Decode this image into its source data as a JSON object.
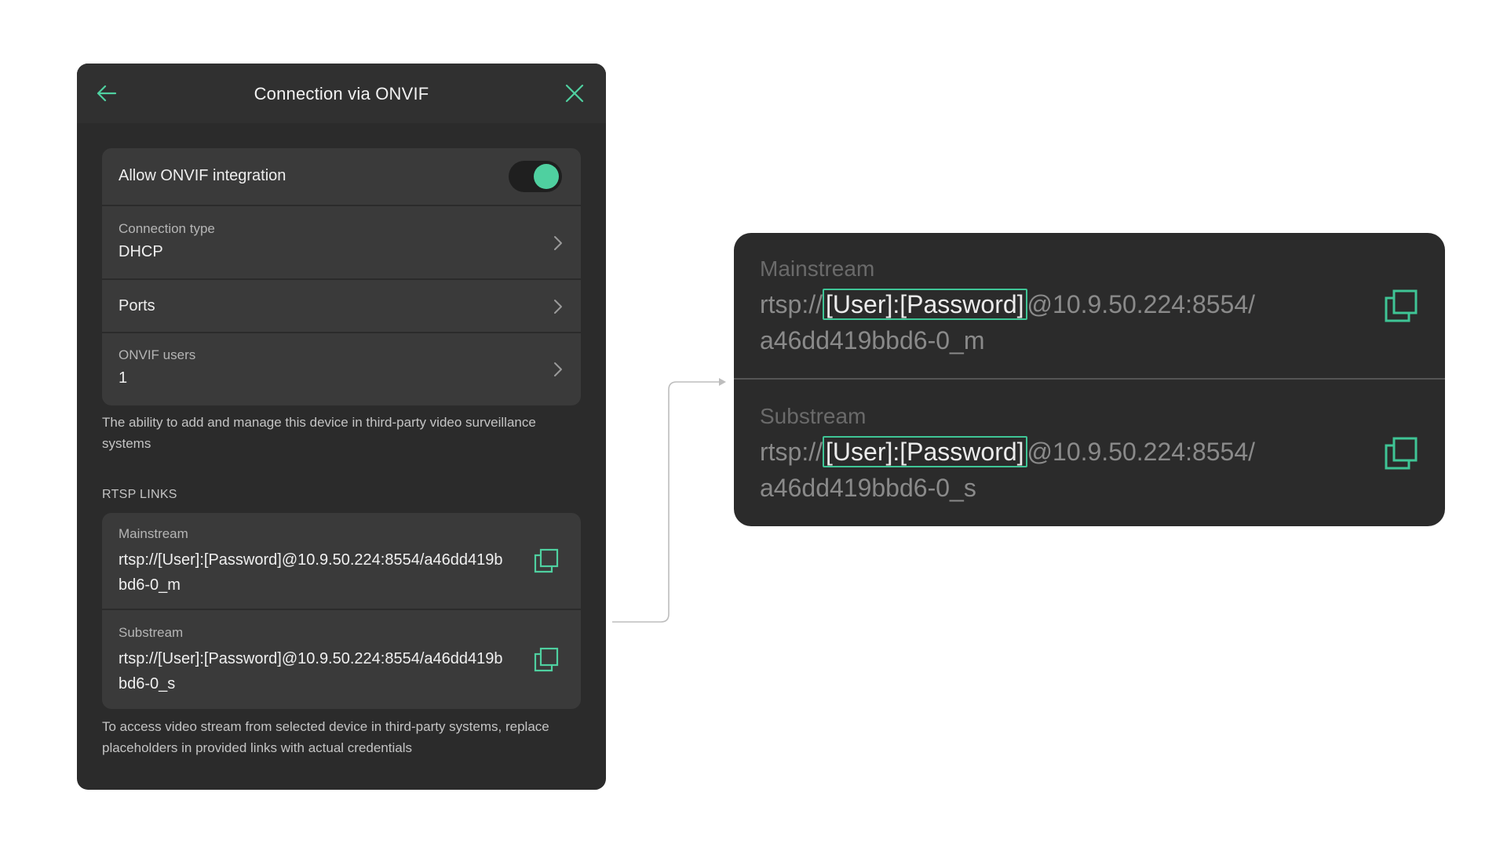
{
  "dialog": {
    "title": "Connection via ONVIF",
    "allow_onvif": {
      "label": "Allow ONVIF integration",
      "enabled": true
    },
    "connection_type": {
      "label": "Connection type",
      "value": "DHCP"
    },
    "ports": {
      "label": "Ports"
    },
    "onvif_users": {
      "label": "ONVIF users",
      "value": "1"
    },
    "integration_hint": "The ability to add and manage this device in third-party video surveillance systems",
    "rtsp_section_label": "RTSP LINKS",
    "rtsp_links": [
      {
        "label": "Mainstream",
        "url": "rtsp://[User]:[Password]@10.9.50.224:8554/a46dd419bbd6-0_m"
      },
      {
        "label": "Substream",
        "url": "rtsp://[User]:[Password]@10.9.50.224:8554/a46dd419bbd6-0_s"
      }
    ],
    "rtsp_hint": "To access video stream from selected device in third-party systems, replace placeholders in provided links with actual credentials"
  },
  "zoom": {
    "links": [
      {
        "label": "Mainstream",
        "prefix": "rtsp://",
        "credentials": "[User]:[Password]",
        "host": "@10.9.50.224:8554/",
        "path": "a46dd419bbd6-0_m"
      },
      {
        "label": "Substream",
        "prefix": "rtsp://",
        "credentials": "[User]:[Password]",
        "host": "@10.9.50.224:8554/",
        "path": "a46dd419bbd6-0_s"
      }
    ]
  },
  "colors": {
    "accent": "#4fd0a0",
    "highlight_border": "#3fc596",
    "panel_bg": "#2b2b2b",
    "card_bg": "#3a3a3a",
    "header_bg": "#303030"
  },
  "icons": {
    "back": "arrow-left-icon",
    "close": "close-icon",
    "chevron": "chevron-right-icon",
    "copy": "copy-icon"
  }
}
